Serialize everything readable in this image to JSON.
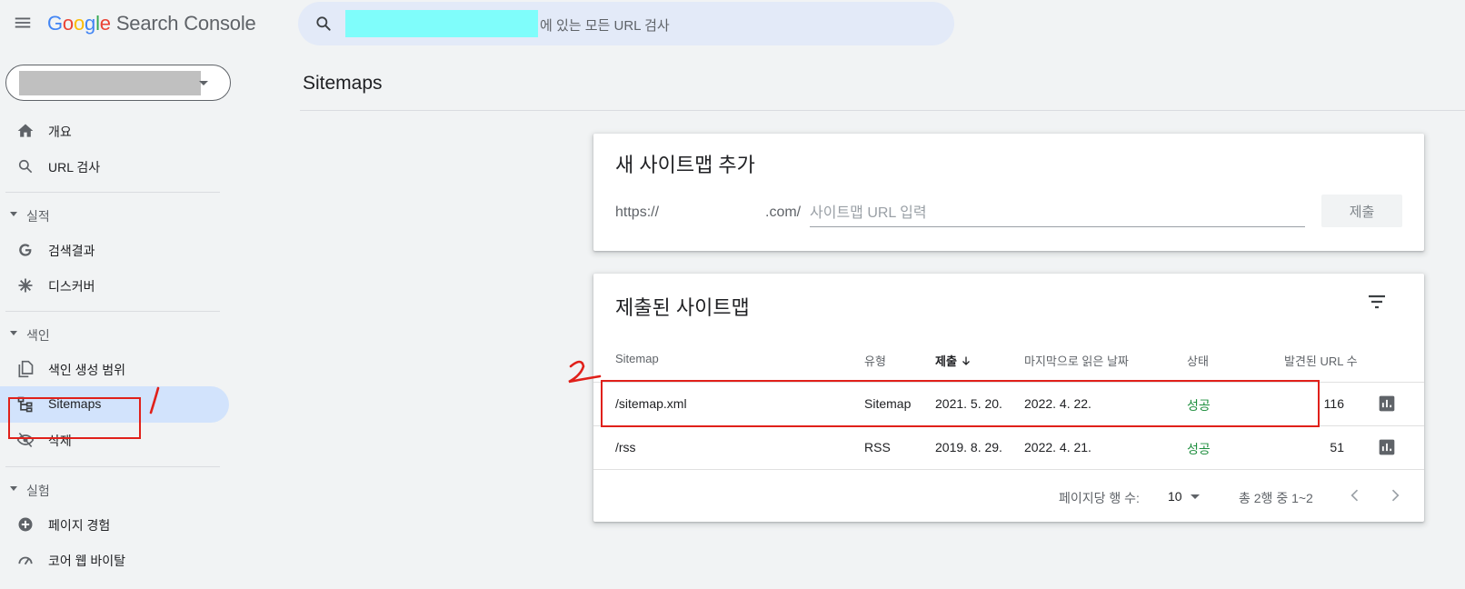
{
  "app": {
    "logo_letters": [
      "G",
      "o",
      "o",
      "g",
      "l",
      "e"
    ],
    "logo_suffix": "Search Console"
  },
  "search": {
    "placeholder": "에 있는 모든 URL 검사"
  },
  "sidebar": {
    "items": [
      {
        "label": "개요",
        "icon": "home-icon"
      },
      {
        "label": "URL 검사",
        "icon": "search-icon"
      },
      {
        "label": "검색결과",
        "icon": "google-g-icon"
      },
      {
        "label": "디스커버",
        "icon": "asterisk-icon"
      },
      {
        "label": "색인 생성 범위",
        "icon": "file-copy-icon"
      },
      {
        "label": "Sitemaps",
        "icon": "sitemap-icon",
        "active": true
      },
      {
        "label": "삭제",
        "icon": "eye-off-icon"
      },
      {
        "label": "페이지 경험",
        "icon": "plus-circle-icon"
      },
      {
        "label": "코어 웹 바이탈",
        "icon": "speedometer-icon"
      }
    ],
    "sections": [
      "실적",
      "색인",
      "실험"
    ]
  },
  "main": {
    "page_title": "Sitemaps",
    "add_card": {
      "title": "새 사이트맵 추가",
      "prefix": "https://",
      "domain_suffix": ".com/",
      "input_placeholder": "사이트맵 URL 입력",
      "submit_label": "제출"
    },
    "submitted_card": {
      "title": "제출된 사이트맵",
      "columns": {
        "sitemap": "Sitemap",
        "type": "유형",
        "submitted": "제출",
        "last_read": "마지막으로 읽은 날짜",
        "status": "상태",
        "discovered": "발견된 URL 수"
      },
      "rows": [
        {
          "sitemap": "/sitemap.xml",
          "type": "Sitemap",
          "submitted": "2021. 5. 20.",
          "last_read": "2022. 4. 22.",
          "status": "성공",
          "discovered": "116"
        },
        {
          "sitemap": "/rss",
          "type": "RSS",
          "submitted": "2019. 8. 29.",
          "last_read": "2022. 4. 21.",
          "status": "성공",
          "discovered": "51"
        }
      ],
      "pagination": {
        "rows_per_page_label": "페이지당 행 수:",
        "rows_per_page_value": "10",
        "range": "총 2행 중 1~2"
      }
    }
  },
  "annotations": {
    "mark_1": "1",
    "mark_2": "2",
    "color": "#e0201a"
  },
  "colors": {
    "active_nav": "#d2e3fc",
    "success": "#1e8e3e",
    "search_bg": "#e3eaf8"
  }
}
